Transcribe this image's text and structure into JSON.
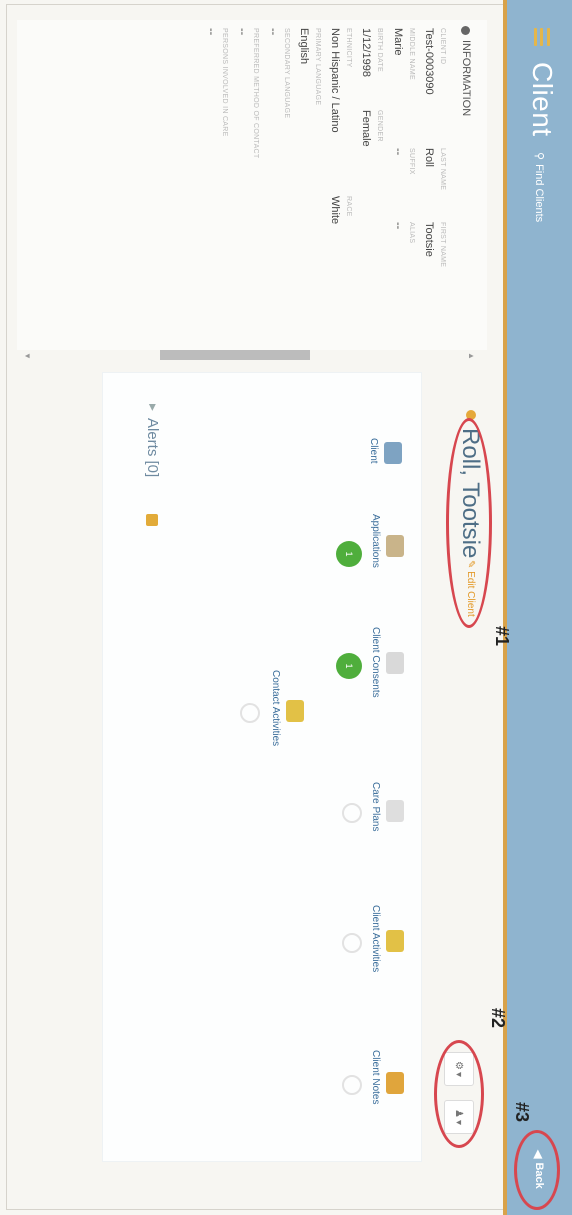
{
  "app": {
    "title": "Client",
    "find_clients": "Find Clients",
    "back": "Back"
  },
  "info": {
    "header": "INFORMATION",
    "rows": [
      {
        "labels": [
          "CLIENT ID",
          "LAST NAME",
          "FIRST NAME"
        ],
        "values": [
          "Test-0003090",
          "Roll",
          "Tootsie"
        ]
      },
      {
        "labels": [
          "MIDDLE NAME",
          "SUFFIX",
          "ALIAS"
        ],
        "values": [
          "Marie",
          "--",
          "--"
        ]
      },
      {
        "labels": [
          "BIRTH DATE",
          "GENDER"
        ],
        "values": [
          "1/12/1998",
          "Female"
        ]
      },
      {
        "labels": [
          "ETHNICITY",
          "RACE"
        ],
        "values": [
          "Non Hispanic / Latino",
          "White"
        ]
      },
      {
        "labels": [
          "PRIMARY LANGUAGE"
        ],
        "values": [
          "English"
        ]
      },
      {
        "labels": [
          "SECONDARY LANGUAGE"
        ],
        "values": [
          "--"
        ]
      },
      {
        "labels": [
          "PREFERRED METHOD OF CONTACT"
        ],
        "values": [
          "--"
        ]
      },
      {
        "labels": [
          "PERSONS INVOLVED IN CARE"
        ],
        "values": [
          "--"
        ]
      }
    ]
  },
  "client": {
    "name": "Roll, Tootsie",
    "edit": "Edit Client"
  },
  "tiles": [
    {
      "label": "Client",
      "icon": "client-card-icon",
      "badge": ""
    },
    {
      "label": "Applications",
      "icon": "applications-icon",
      "badge": "1"
    },
    {
      "label": "Client Consents",
      "icon": "consents-icon",
      "badge": "1"
    },
    {
      "label": "Contact Activities",
      "icon": "contact-activities-icon",
      "badge": ""
    },
    {
      "label": "Care Plans",
      "icon": "care-plans-icon",
      "badge": ""
    },
    {
      "label": "Client Activities",
      "icon": "client-activities-icon",
      "badge": ""
    },
    {
      "label": "Client Notes",
      "icon": "client-notes-icon",
      "badge": ""
    }
  ],
  "alerts": {
    "label": "Alerts [0]"
  },
  "annotations": [
    "#1",
    "#2",
    "#3"
  ],
  "colors": {
    "header": "#8fb4cf",
    "accent": "#d8a24a",
    "annotation": "#d7474f",
    "badge": "#4fae3c",
    "link": "#3b6e9b"
  }
}
